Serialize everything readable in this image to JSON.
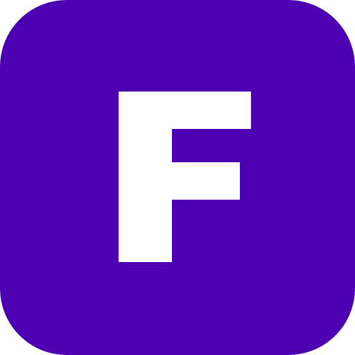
{
  "icon": {
    "semantic": "letter-f-logo-icon",
    "letter": "F",
    "colors": {
      "background": "#4B00B2",
      "foreground": "#FFFFFF"
    }
  }
}
